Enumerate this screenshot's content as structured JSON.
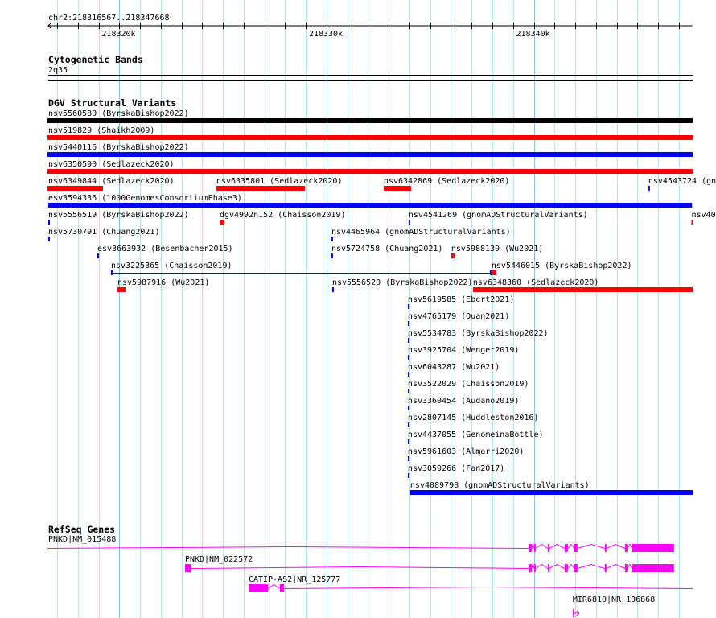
{
  "region": {
    "chrom": "chr2",
    "start": 218316567,
    "end": 218347668,
    "label": "chr2:218316567..218347668"
  },
  "ruler": {
    "major_labels": [
      {
        "pos": 218320000,
        "label": "218320k"
      },
      {
        "pos": 218330000,
        "label": "218330k"
      },
      {
        "pos": 218340000,
        "label": "218340k"
      }
    ]
  },
  "colors": {
    "grid_minor": "#b0e4ee",
    "grid_major": "#88c4e8",
    "gene": "#ff00ff",
    "red": "#ff0000",
    "blue": "#0000ff",
    "black": "#000000"
  },
  "cytobands": {
    "title": "Cytogenetic Bands",
    "band": "2q35"
  },
  "dgv": {
    "title": "DGV Structural Variants",
    "rows": [
      [
        {
          "label": "nsv5560580 (ByrskaBishop2022)",
          "start": 218316000,
          "end": 218348000,
          "color": "#000000"
        }
      ],
      [
        {
          "label": "nsv519829 (Shaikh2009)",
          "start": 218316000,
          "end": 218348000,
          "color": "#ff0000"
        }
      ],
      [
        {
          "label": "nsv5440116 (ByrskaBishop2022)",
          "start": 218316000,
          "end": 218348000,
          "color": "#0000ff"
        }
      ],
      [
        {
          "label": "nsv6350590 (Sedlazeck2020)",
          "start": 218316000,
          "end": 218348000,
          "color": "#ff0000"
        }
      ],
      [
        {
          "label": "nsv6349844 (Sedlazeck2020)",
          "start": 218316000,
          "end": 218319207,
          "color": "#ff0000"
        },
        {
          "label": "nsv6335801 (Sedlazeck2020)",
          "start": 218324680,
          "end": 218328951,
          "color": "#ff0000"
        },
        {
          "label": "nsv6342869 (Sedlazeck2020)",
          "start": 218332755,
          "end": 218334075,
          "color": "#ff0000"
        },
        {
          "label": "nsv4543724 (gn",
          "start": 218345527,
          "end": 218345600,
          "color": "#0000ff"
        }
      ],
      [
        {
          "label": "esv3594336 (1000GenomesConsortiumPhase3)",
          "start": 218316567,
          "end": 218347640,
          "color": "#0000ff"
        }
      ],
      [
        {
          "label": "nsv5556519 (ByrskaBishop2022)",
          "start": 218316567,
          "end": 218316640,
          "color": "#0000ff"
        },
        {
          "label": "dgv4992n152 (Chaisson2019)",
          "start": 218324836,
          "end": 218325069,
          "color": "#ff0000"
        },
        {
          "label": "nsv4541269 (gnomADStructuralVariants)",
          "start": 218333958,
          "end": 218334030,
          "color": "#0000ff"
        },
        {
          "label": "nsv40",
          "start": 218347610,
          "end": 218347668,
          "color": "#ff0000"
        }
      ],
      [
        {
          "label": "nsv5730791 (Chuang2021)",
          "start": 218316567,
          "end": 218316640,
          "color": "#0000ff"
        },
        {
          "label": "nsv4465964 (gnomADStructuralVariants)",
          "start": 218330232,
          "end": 218330300,
          "color": "#0000ff"
        }
      ],
      [
        {
          "label": "esv3663932 (Besenbacher2015)",
          "start": 218318935,
          "end": 218319000,
          "color": "#0000ff"
        },
        {
          "label": "nsv5724758 (Chuang2021)",
          "start": 218330232,
          "end": 218330300,
          "color": "#0000ff"
        },
        {
          "label": "nsv5988139 (Wu2021)",
          "start": 218336016,
          "end": 218336172,
          "color": "#ff0000"
        }
      ],
      [
        {
          "label": "nsv3225365 (Chaisson2019)",
          "start": 218319595,
          "end": 218337957,
          "color": "#0000ff",
          "style": "thin"
        },
        {
          "label": "nsv5446015 (ByrskaBishop2022)",
          "start": 218337957,
          "end": 218338190,
          "color": "#ff0000"
        }
      ],
      [
        {
          "label": "nsv5987916 (Wu2021)",
          "start": 218319906,
          "end": 218320294,
          "color": "#ff0000"
        },
        {
          "label": "nsv5556520 (ByrskaBishop2022)",
          "start": 218330271,
          "end": 218330340,
          "color": "#0000ff"
        },
        {
          "label": "nsv6348360 (Sedlazeck2020)",
          "start": 218337064,
          "end": 218348000,
          "color": "#ff0000"
        }
      ],
      [
        {
          "label": "nsv5619585 (Ebert2021)",
          "start": 218333920,
          "end": 218333980,
          "color": "#0000ff"
        }
      ],
      [
        {
          "label": "nsv4765179 (Quan2021)",
          "start": 218333920,
          "end": 218333980,
          "color": "#0000ff"
        }
      ],
      [
        {
          "label": "nsv5534783 (ByrskaBishop2022)",
          "start": 218333920,
          "end": 218333980,
          "color": "#0000ff"
        }
      ],
      [
        {
          "label": "nsv3925704 (Wenger2019)",
          "start": 218333920,
          "end": 218333980,
          "color": "#0000ff"
        }
      ],
      [
        {
          "label": "nsv6043287 (Wu2021)",
          "start": 218333920,
          "end": 218333980,
          "color": "#0000ff"
        }
      ],
      [
        {
          "label": "nsv3522029 (Chaisson2019)",
          "start": 218333920,
          "end": 218333980,
          "color": "#0000ff"
        }
      ],
      [
        {
          "label": "nsv3360454 (Audano2019)",
          "start": 218333920,
          "end": 218333980,
          "color": "#0000ff"
        }
      ],
      [
        {
          "label": "nsv2807145 (Huddleston2016)",
          "start": 218333920,
          "end": 218333980,
          "color": "#0000ff"
        }
      ],
      [
        {
          "label": "nsv4437055 (GenomeinaBottle)",
          "start": 218333920,
          "end": 218333980,
          "color": "#0000ff"
        }
      ],
      [
        {
          "label": "nsv5961603 (Almarri2020)",
          "start": 218333920,
          "end": 218333980,
          "color": "#0000ff"
        }
      ],
      [
        {
          "label": "nsv3059266 (Fan2017)",
          "start": 218333920,
          "end": 218333980,
          "color": "#0000ff"
        }
      ],
      [
        {
          "label": "nsv4089798 (gnomADStructuralVariants)",
          "start": 218334036,
          "end": 218348000,
          "color": "#0000ff"
        }
      ]
    ]
  },
  "genes": {
    "title": "RefSeq Genes",
    "items": [
      {
        "label": "PNKD|NM_015488",
        "start": 218316000,
        "end": 218346769,
        "exons": [
          [
            218339743,
            218339898
          ],
          [
            218340014,
            218340092
          ],
          [
            218340674,
            218340752
          ],
          [
            218341489,
            218341645
          ],
          [
            218341955,
            218342111
          ],
          [
            218343430,
            218343508
          ],
          [
            218344401,
            218344517
          ],
          [
            218344750,
            218346769
          ]
        ]
      },
      {
        "label": "PNKD|NM_022572",
        "start": 218323166,
        "end": 218346769,
        "exons": [
          [
            218323166,
            218323477
          ],
          [
            218339743,
            218339898
          ],
          [
            218340014,
            218340092
          ],
          [
            218340674,
            218340752
          ],
          [
            218341489,
            218341645
          ],
          [
            218341955,
            218342111
          ],
          [
            218343430,
            218343508
          ],
          [
            218344401,
            218344517
          ],
          [
            218344750,
            218346769
          ]
        ]
      },
      {
        "label": "CATIP-AS2|NR_125777",
        "start": 218326233,
        "end": 218348000,
        "exons": [
          [
            218326233,
            218327165
          ],
          [
            218327747,
            218327941
          ]
        ]
      },
      {
        "label": "MIR6810|NR_106868",
        "start": 218341878,
        "end": 218341900,
        "exons": [],
        "arrow": true
      }
    ]
  }
}
